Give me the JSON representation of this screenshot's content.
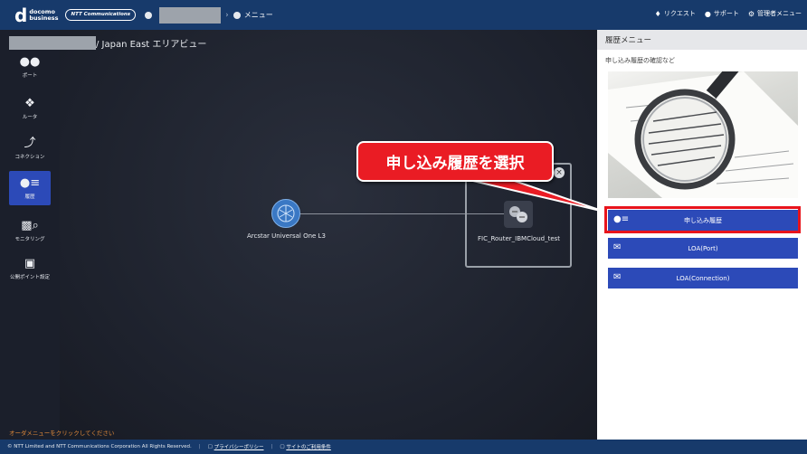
{
  "header": {
    "logo_mark": "d",
    "logo_line1": "docomo",
    "logo_line2": "business",
    "ntt_badge": "NTT Communications",
    "breadcrumb_menu": "メニュー",
    "right_links": [
      {
        "icon": "bell-icon",
        "label": "リクエスト"
      },
      {
        "icon": "help-icon",
        "label": "サポート"
      },
      {
        "icon": "gear-icon",
        "label": "管理者メニュー"
      }
    ]
  },
  "sidebar": {
    "items": [
      {
        "icon": "port-icon",
        "label": "ポート",
        "active": false
      },
      {
        "icon": "router-icon",
        "label": "ルータ",
        "active": false
      },
      {
        "icon": "connection-icon",
        "label": "コネクション",
        "active": false
      },
      {
        "icon": "history-icon",
        "label": "履歴",
        "active": true
      },
      {
        "icon": "monitoring-icon",
        "label": "モニタリング",
        "active": false
      },
      {
        "icon": "public-point-icon",
        "label": "公開ポイント設定",
        "active": false
      }
    ]
  },
  "main": {
    "title_suffix": "/ Japan East エリアビュー",
    "nodes": {
      "arcstar": "Arcstar Universal One L3",
      "router": "FIC_Router_IBMCloud_test"
    },
    "order_hint": "オーダメニューをクリックしてください"
  },
  "callout": {
    "text": "申し込み履歴を選択"
  },
  "panel": {
    "title": "履歴メニュー",
    "subtitle": "申し込み履歴の確認など",
    "buttons": [
      {
        "icon": "history-icon",
        "label": "申し込み履歴"
      },
      {
        "icon": "envelope-icon",
        "label": "LOA(Port)"
      },
      {
        "icon": "envelope-icon",
        "label": "LOA(Connection)"
      }
    ]
  },
  "footer": {
    "copyright": "© NTT Limited and NTT Communications Corporation All Rights Reserved.",
    "privacy": "プライバシーポリシー",
    "terms": "サイトのご利用条件"
  },
  "colors": {
    "header_bg": "#173a6b",
    "accent": "#2c4ab8",
    "callout": "#ea1c24"
  }
}
